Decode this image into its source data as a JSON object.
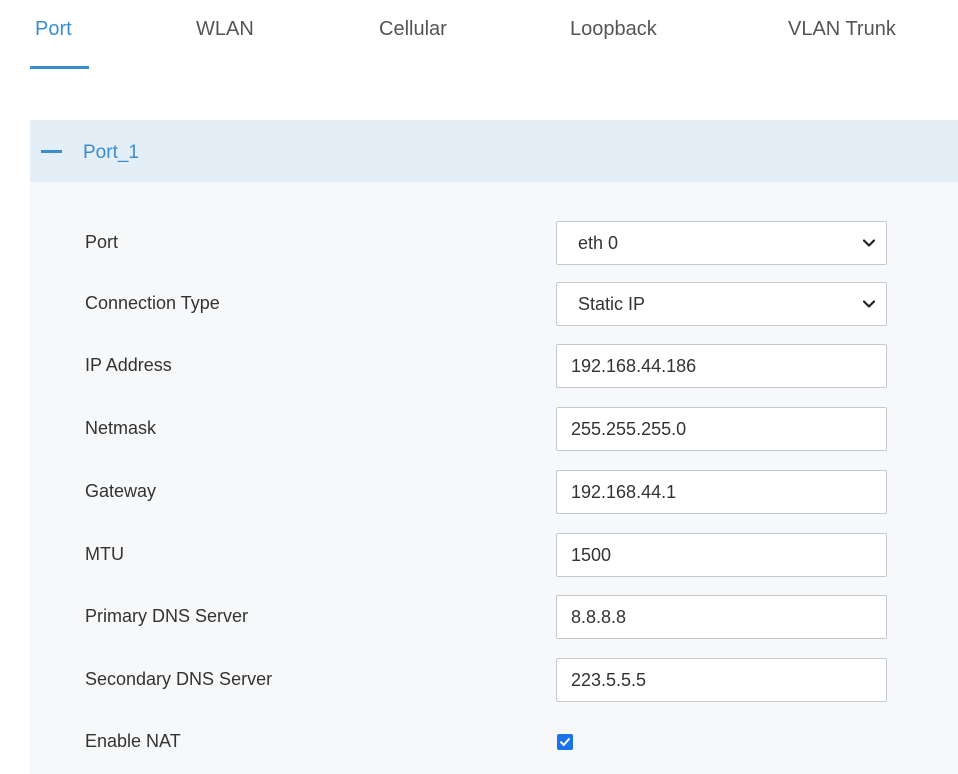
{
  "tabs": [
    {
      "label": "Port",
      "active": true
    },
    {
      "label": "WLAN",
      "active": false
    },
    {
      "label": "Cellular",
      "active": false
    },
    {
      "label": "Loopback",
      "active": false
    },
    {
      "label": "VLAN Trunk",
      "active": false
    }
  ],
  "panel": {
    "title": "Port_1",
    "collapse_icon": "minus-icon"
  },
  "form": {
    "port": {
      "label": "Port",
      "value": "eth 0"
    },
    "connection_type": {
      "label": "Connection Type",
      "value": "Static IP"
    },
    "ip_address": {
      "label": "IP Address",
      "value": "192.168.44.186"
    },
    "netmask": {
      "label": "Netmask",
      "value": "255.255.255.0"
    },
    "gateway": {
      "label": "Gateway",
      "value": "192.168.44.1"
    },
    "mtu": {
      "label": "MTU",
      "value": "1500"
    },
    "primary_dns": {
      "label": "Primary DNS Server",
      "value": "8.8.8.8"
    },
    "secondary_dns": {
      "label": "Secondary DNS Server",
      "value": "223.5.5.5"
    },
    "enable_nat": {
      "label": "Enable NAT",
      "checked": true
    }
  },
  "colors": {
    "accent": "#3a8ed0",
    "header_bg": "#e3eef7",
    "panel_bg": "#f7f8f9",
    "checkbox": "#1a73e8"
  }
}
